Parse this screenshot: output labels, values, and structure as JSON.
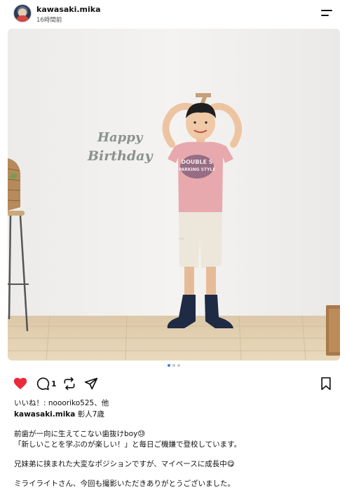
{
  "header": {
    "username": "kawasaki.mika",
    "timestamp": "16時間前",
    "avatar_icon": "profile-avatar",
    "menu_icon": "hamburger-menu-icon"
  },
  "photo": {
    "sign_line1": "Happy",
    "sign_line2": "Birthday",
    "shirt_line1": "DOUBLE S",
    "shirt_line2": "PARKING STYLE",
    "carousel_count": 3,
    "carousel_active": 1
  },
  "actions": {
    "comment_count": "1",
    "liked": true,
    "heart_color": "#ed2a3a"
  },
  "likes_text": "いいね！: noooriko525、他",
  "caption": {
    "user": "kawasaki.mika",
    "first_line": " 彰人7歳",
    "lines": [
      "前歯が一向に生えてこない歯抜けboy😓",
      "「新しいことを学ぶのが楽しい！」と毎日ご機嫌で登校しています。",
      "兄妹弟に挟まれた大変なポジションですが、マイペースに成長中😋",
      "ミライライトさん、今回も撮影いただきありがとうございました。"
    ]
  }
}
